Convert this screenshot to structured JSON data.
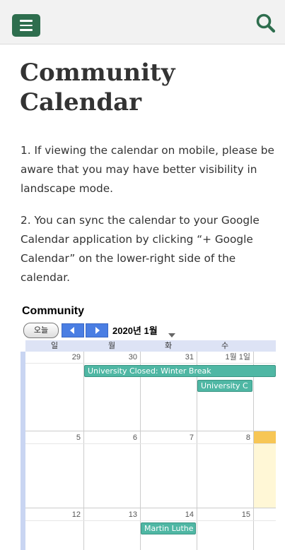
{
  "header": {
    "menu_icon": "hamburger-menu-icon",
    "search_icon": "search-icon",
    "brand_color": "#2e6e4e"
  },
  "page": {
    "title_line1": "Community",
    "title_line2": "Calendar",
    "paragraphs": [
      "1. If viewing the calendar on mobile, please be aware that you may have better visibility in landscape mode.",
      "2. You can sync the calendar to your Google Calendar application by clicking “+ Google Calendar” on the lower-right side of the calendar."
    ]
  },
  "calendar": {
    "title": "Community",
    "today_label": "오늘",
    "prev_icon": "chevron-left-icon",
    "next_icon": "chevron-right-icon",
    "date_range": "2020년 1월",
    "dropdown_icon": "caret-down-icon",
    "day_headers": [
      "일",
      "월",
      "화",
      "수"
    ],
    "weeks": [
      [
        "29",
        "30",
        "31",
        "1월 1일"
      ],
      [
        "5",
        "6",
        "7",
        "8"
      ],
      [
        "12",
        "13",
        "14",
        "15"
      ]
    ],
    "events": [
      {
        "label": "University Closed: Winter Break",
        "color": "#4fb7a4"
      },
      {
        "label": "University C",
        "color": "#4fb7a4"
      },
      {
        "label": "Martin Luthe",
        "color": "#4fb7a4"
      }
    ],
    "nav_color": "#4a7ee3",
    "today_highlight": "#f7c655"
  }
}
